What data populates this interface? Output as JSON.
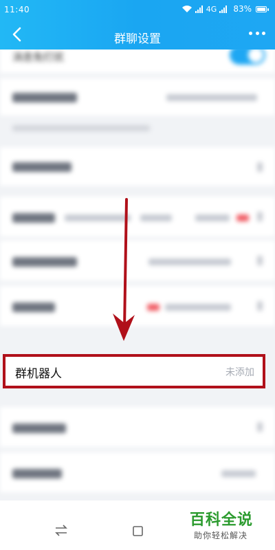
{
  "status_bar": {
    "time": "11:40",
    "network": "4G",
    "battery_text": "83%",
    "battery_level": 0.83
  },
  "header": {
    "title": "群聊设置"
  },
  "settings": {
    "partial_top_text": "消息免打扰",
    "highlighted_item": {
      "label": "群机器人",
      "status": "未添加"
    }
  },
  "watermark": {
    "title": "百科全说",
    "subtitle": "助你轻松解决"
  },
  "colors": {
    "header_start": "#22b8f5",
    "header_end": "#1aa6f2",
    "highlight_border": "#b0101a",
    "arrow": "#b0101a",
    "watermark_green": "#2b9b2e"
  }
}
